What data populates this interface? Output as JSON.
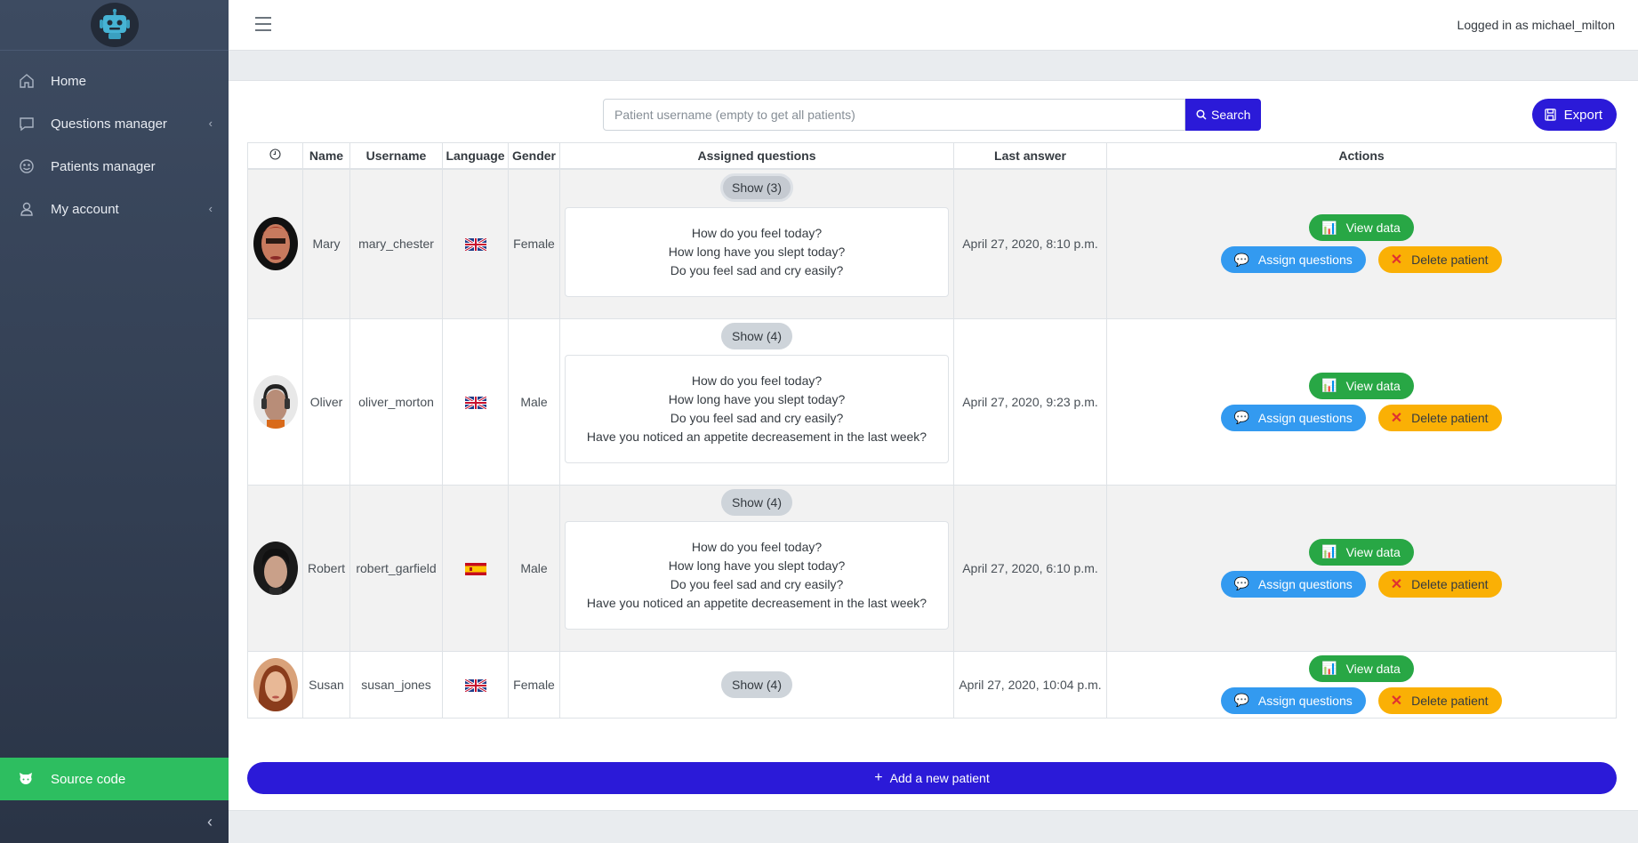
{
  "sidebar": {
    "items": [
      {
        "label": "Home",
        "icon": "home-icon"
      },
      {
        "label": "Questions manager",
        "icon": "chat-icon"
      },
      {
        "label": "Patients manager",
        "icon": "smile-icon"
      },
      {
        "label": "My account",
        "icon": "user-icon"
      }
    ],
    "source_label": "Source code"
  },
  "topbar": {
    "logged_in": "Logged in as michael_milton"
  },
  "search": {
    "placeholder": "Patient username (empty to get all patients)",
    "button": "Search"
  },
  "export_label": "Export",
  "table": {
    "headers": [
      "Name",
      "Username",
      "Language",
      "Gender",
      "Assigned questions",
      "Last answer",
      "Actions"
    ],
    "actions": {
      "view": "View data",
      "assign": "Assign questions",
      "delete": "Delete patient"
    },
    "rows": [
      {
        "name": "Mary",
        "username": "mary_chester",
        "language": "uk",
        "gender": "Female",
        "show": "Show (3)",
        "questions": [
          "How do you feel today?",
          "How long have you slept today?",
          "Do you feel sad and cry easily?"
        ],
        "last_answer": "April 27, 2020, 8:10 p.m."
      },
      {
        "name": "Oliver",
        "username": "oliver_morton",
        "language": "uk",
        "gender": "Male",
        "show": "Show (4)",
        "questions": [
          "How do you feel today?",
          "How long have you slept today?",
          "Do you feel sad and cry easily?",
          "Have you noticed an appetite decreasement in the last week?"
        ],
        "last_answer": "April 27, 2020, 9:23 p.m."
      },
      {
        "name": "Robert",
        "username": "robert_garfield",
        "language": "es",
        "gender": "Male",
        "show": "Show (4)",
        "questions": [
          "How do you feel today?",
          "How long have you slept today?",
          "Do you feel sad and cry easily?",
          "Have you noticed an appetite decreasement in the last week?"
        ],
        "last_answer": "April 27, 2020, 6:10 p.m."
      },
      {
        "name": "Susan",
        "username": "susan_jones",
        "language": "uk",
        "gender": "Female",
        "show": "Show (4)",
        "questions": [],
        "last_answer": "April 27, 2020, 10:04 p.m."
      }
    ]
  },
  "add_patient_label": "Add a new patient",
  "colors": {
    "primary": "#2b1ad8",
    "green": "#28a745",
    "blue": "#339af0",
    "yellow": "#fab005",
    "sidebar": "#3d4b61"
  }
}
